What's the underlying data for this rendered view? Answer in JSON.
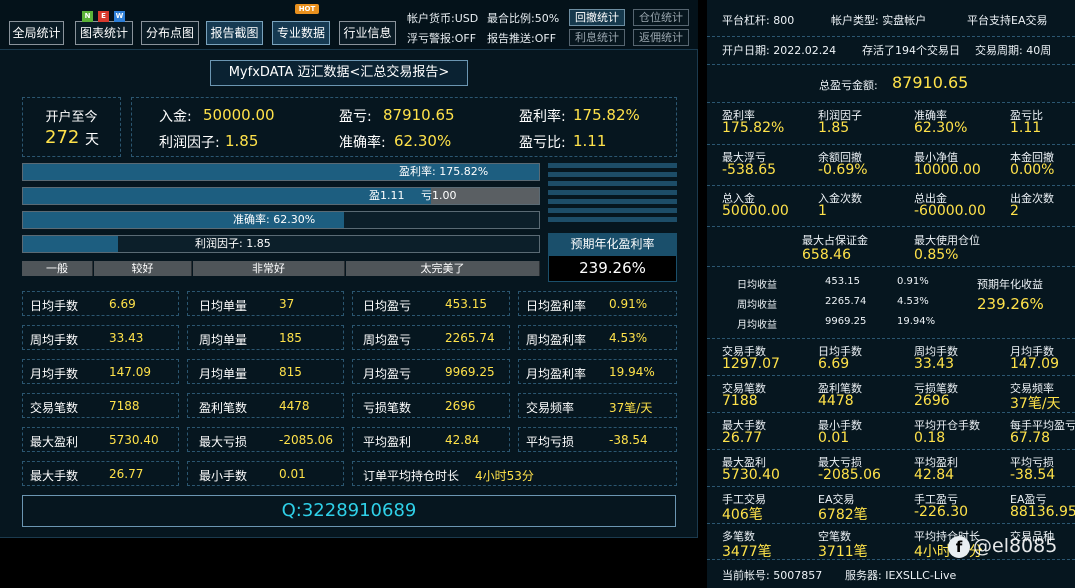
{
  "toolbar": {
    "buttons": [
      "全局统计",
      "图表统计",
      "分布点图",
      "报告截图",
      "专业数据",
      "行业信息"
    ],
    "new_letters": [
      "N",
      "E",
      "W"
    ],
    "hot_label": "HOT",
    "info": [
      "帐户货币:USD",
      "最合比例:50%",
      "浮亏警报:OFF",
      "报告推送:OFF"
    ],
    "mini_buttons": [
      "回撤统计",
      "仓位统计",
      "利息统计",
      "返佣统计"
    ]
  },
  "report_title": "MyfxDATA 迈汇数据<汇总交易报告>",
  "summary": {
    "open_label": "开户至今",
    "days": "272",
    "days_unit": "天",
    "deposit_label": "入金:",
    "deposit": "50000.00",
    "profit_label": "盈亏:",
    "profit": "87910.65",
    "profit_rate_label": "盈利率:",
    "profit_rate": "175.82%",
    "profit_factor_label": "利润因子:",
    "profit_factor": "1.85",
    "accuracy_label": "准确率:",
    "accuracy": "62.30%",
    "pl_ratio_label": "盈亏比:",
    "pl_ratio": "1.11"
  },
  "bars": {
    "profit_rate_text": "盈利率: 175.82%",
    "profit_rate_fill": 1.0,
    "win_text": "盈1.11",
    "loss_text": "亏1.00",
    "win_fill": 0.79,
    "accuracy_text": "准确率: 62.30%",
    "accuracy_fill": 0.623,
    "factor_text": "利润因子: 1.85",
    "factor_fill": 0.185,
    "levels": [
      "一般",
      "较好",
      "非常好",
      "太完美了"
    ]
  },
  "annual": {
    "label": "预期年化盈利率",
    "value": "239.26%"
  },
  "grid": [
    [
      [
        "日均手数",
        "6.69"
      ],
      [
        "日均单量",
        "37"
      ],
      [
        "日均盈亏",
        "453.15"
      ],
      [
        "日均盈利率",
        "0.91%"
      ]
    ],
    [
      [
        "周均手数",
        "33.43"
      ],
      [
        "周均单量",
        "185"
      ],
      [
        "周均盈亏",
        "2265.74"
      ],
      [
        "周均盈利率",
        "4.53%"
      ]
    ],
    [
      [
        "月均手数",
        "147.09"
      ],
      [
        "月均单量",
        "815"
      ],
      [
        "月均盈亏",
        "9969.25"
      ],
      [
        "月均盈利率",
        "19.94%"
      ]
    ],
    [
      [
        "交易笔数",
        "7188"
      ],
      [
        "盈利笔数",
        "4478"
      ],
      [
        "亏损笔数",
        "2696"
      ],
      [
        "交易频率",
        "37笔/天"
      ]
    ],
    [
      [
        "最大盈利",
        "5730.40"
      ],
      [
        "最大亏损",
        "-2085.06"
      ],
      [
        "平均盈利",
        "42.84"
      ],
      [
        "平均亏损",
        "-38.54"
      ]
    ],
    [
      [
        "最大手数",
        "26.77"
      ],
      [
        "最小手数",
        "0.01"
      ],
      [
        "订单平均持仓时长",
        "4小时53分"
      ]
    ]
  ],
  "account_q": "Q:3228910689",
  "right": {
    "row1": [
      "平台杠杆:  800",
      "帐户类型:  实盘帐户",
      "平台支持EA交易"
    ],
    "row2": [
      "开户日期:  2022.02.24",
      "存活了194个交易日",
      "交易周期:  40周"
    ],
    "total_label": "总盈亏金额:",
    "total_value": "87910.65",
    "blocks": [
      [
        [
          "盈利率",
          "175.82%"
        ],
        [
          "利润因子",
          "1.85"
        ],
        [
          "准确率",
          "62.30%"
        ],
        [
          "盈亏比",
          "1.11"
        ]
      ],
      [
        [
          "最大浮亏",
          "-538.65"
        ],
        [
          "余额回撤",
          "-0.69%"
        ],
        [
          "最小净值",
          "10000.00"
        ],
        [
          "本金回撤",
          "0.00%"
        ]
      ],
      [
        [
          "总入金",
          "50000.00"
        ],
        [
          "入金次数",
          "1"
        ],
        [
          "总出金",
          "-60000.00"
        ],
        [
          "出金次数",
          "2"
        ]
      ]
    ],
    "margin": [
      [
        "最大占保证金",
        "658.46"
      ],
      [
        "最大使用仓位",
        "0.85%"
      ]
    ],
    "daily_rows": [
      [
        "日均收益",
        "453.15",
        "0.91%"
      ],
      [
        "周均收益",
        "2265.74",
        "4.53%"
      ],
      [
        "月均收益",
        "9969.25",
        "19.94%"
      ]
    ],
    "annual_label": "预期年化收益",
    "annual_value": "239.26%",
    "blocks2": [
      [
        [
          "交易手数",
          "1297.07"
        ],
        [
          "日均手数",
          "6.69"
        ],
        [
          "周均手数",
          "33.43"
        ],
        [
          "月均手数",
          "147.09"
        ]
      ],
      [
        [
          "交易笔数",
          "7188"
        ],
        [
          "盈利笔数",
          "4478"
        ],
        [
          "亏损笔数",
          "2696"
        ],
        [
          "交易频率",
          "37笔/天"
        ]
      ],
      [
        [
          "最大手数",
          "26.77"
        ],
        [
          "最小手数",
          "0.01"
        ],
        [
          "平均开仓手数",
          "0.18"
        ],
        [
          "每手平均盈亏",
          "67.78"
        ]
      ],
      [
        [
          "最大盈利",
          "5730.40"
        ],
        [
          "最大亏损",
          "-2085.06"
        ],
        [
          "平均盈利",
          "42.84"
        ],
        [
          "平均亏损",
          "-38.54"
        ]
      ],
      [
        [
          "手工交易",
          "406笔"
        ],
        [
          "EA交易",
          "6782笔"
        ],
        [
          "手工盈亏",
          "-226.30"
        ],
        [
          "EA盈亏",
          "88136.95"
        ]
      ],
      [
        [
          "多笔数",
          "3477笔"
        ],
        [
          "空笔数",
          "3711笔"
        ],
        [
          "平均持仓时长",
          "4小时53分"
        ],
        [
          "交易品种",
          ""
        ]
      ]
    ],
    "footer_account": "当前帐号:  5007857",
    "footer_server": "服务器:  IEXSLLC-Live",
    "watermark": "@el8085"
  },
  "colors": {
    "value": "#ffe24a",
    "bar_fill": "#1d5e80",
    "q_text": "#2fd0e8",
    "bg": "#06161f"
  }
}
